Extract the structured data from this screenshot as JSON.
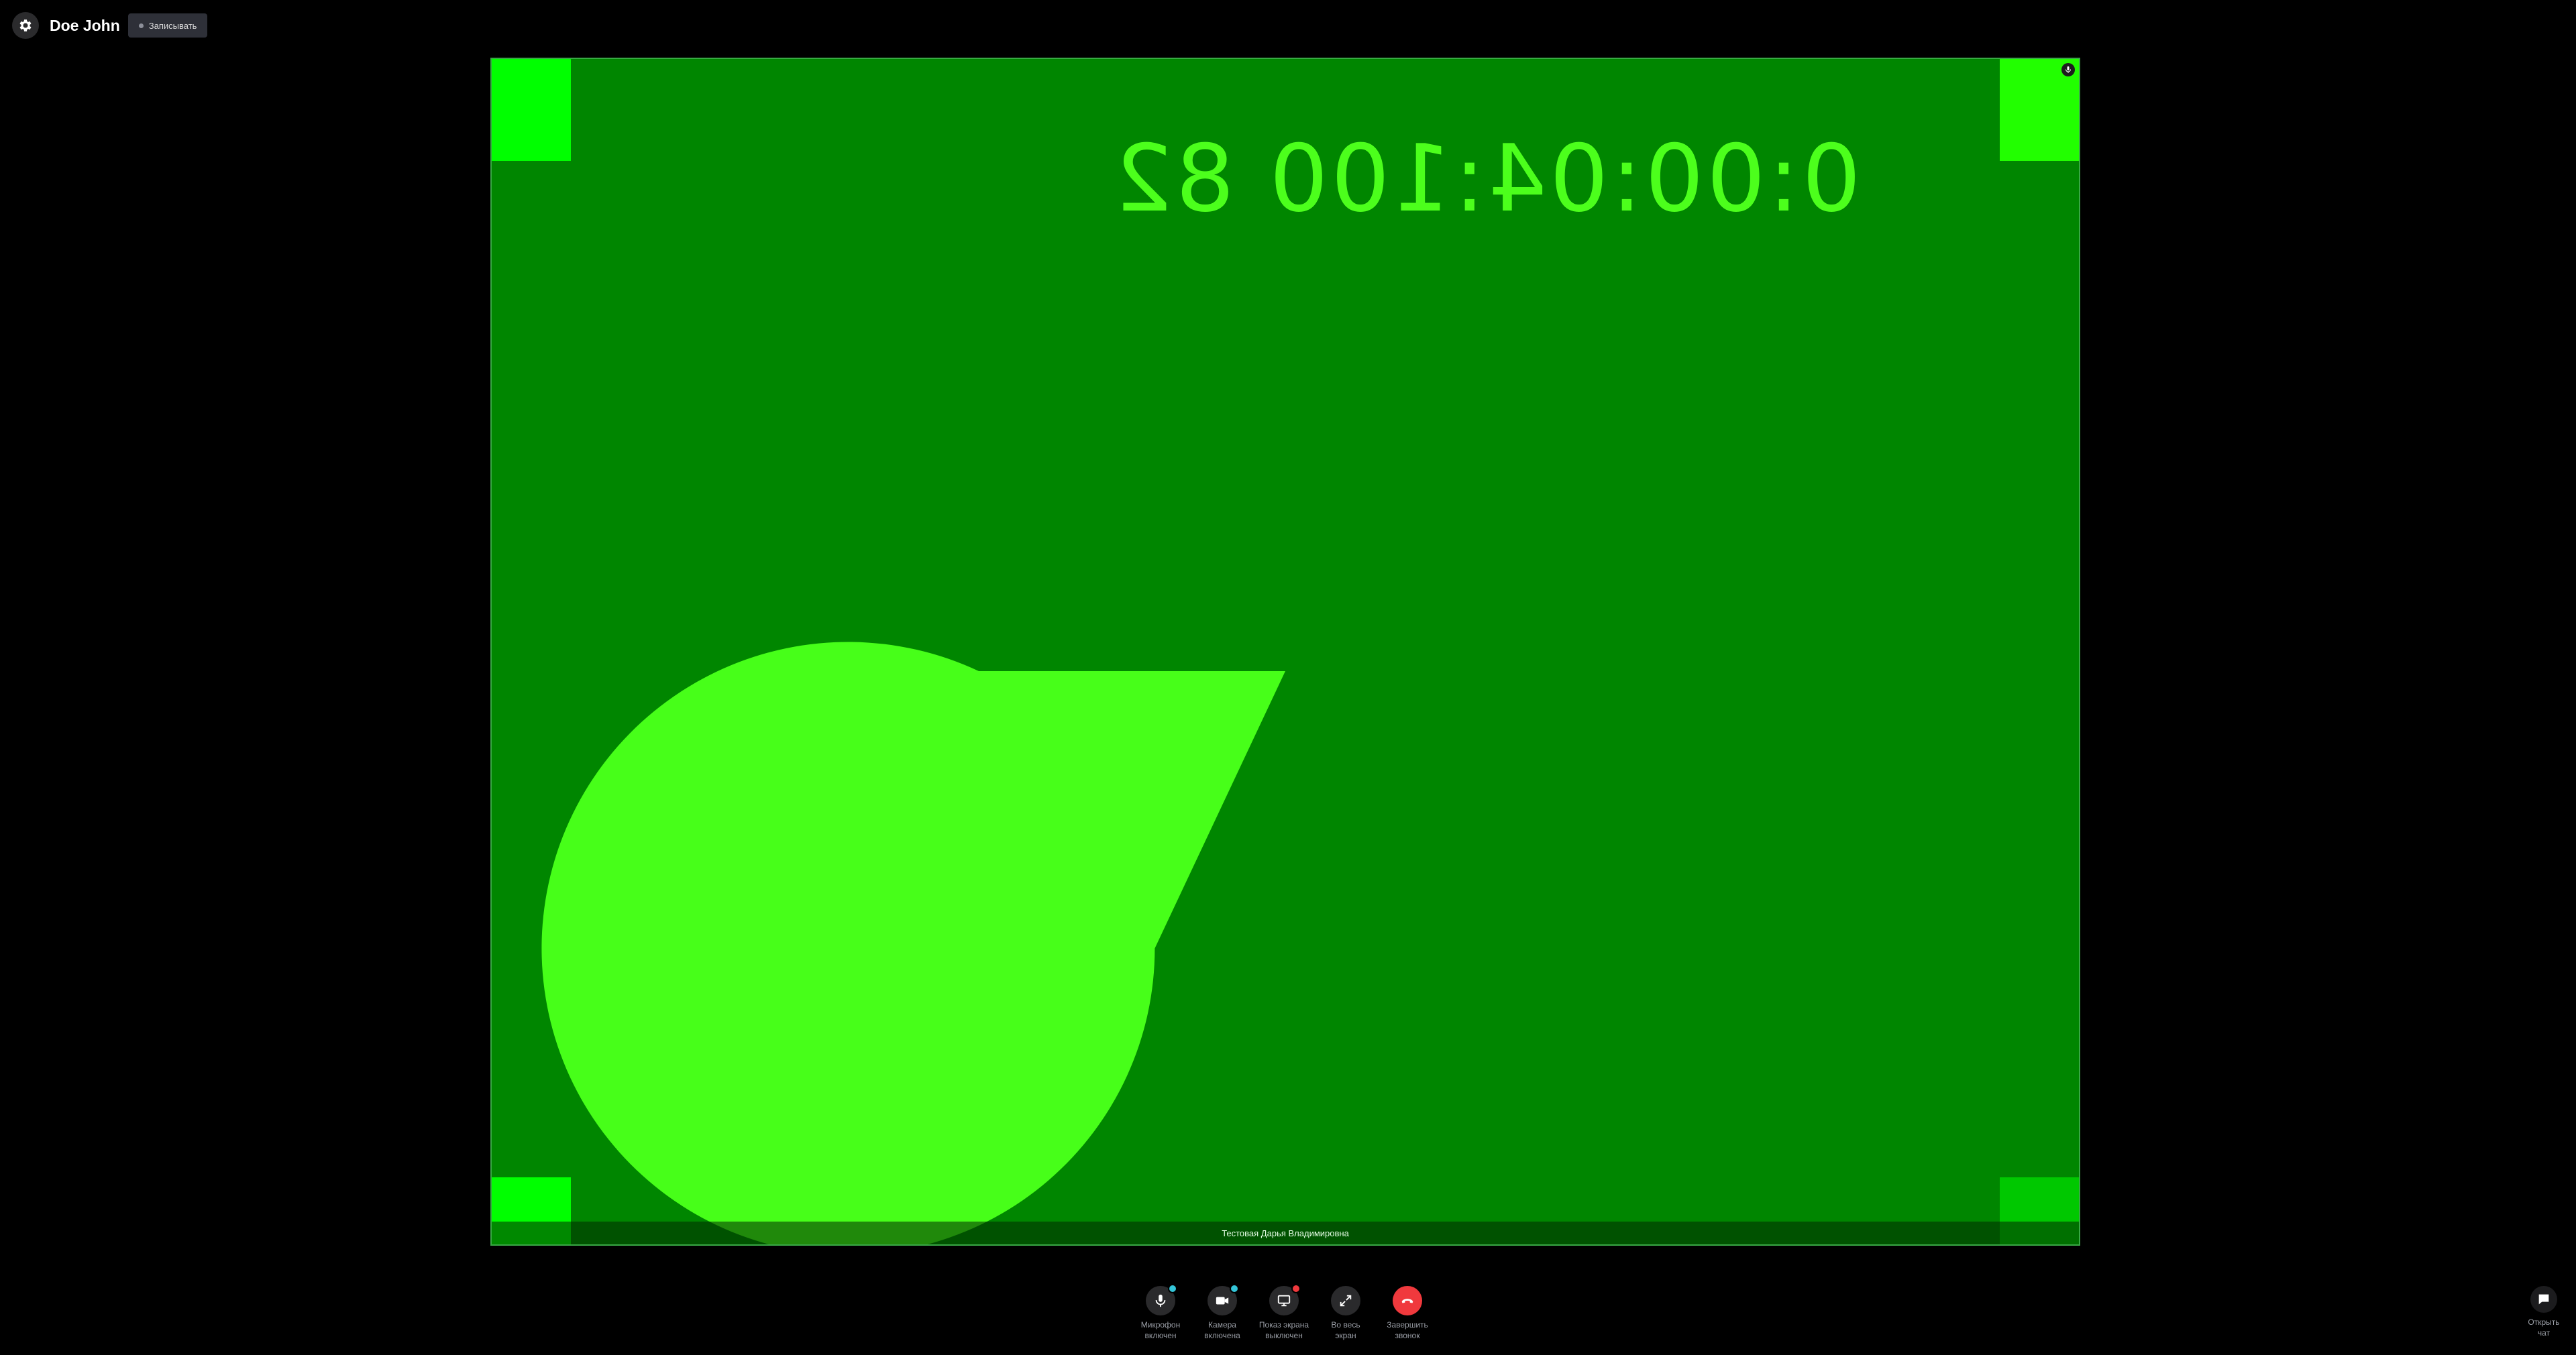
{
  "header": {
    "user_name": "Doe John",
    "record_label": "Записывать",
    "settings_icon": "gear-icon"
  },
  "video": {
    "participant_name": "Тестовая Дарья Владимировна",
    "overlay_timecode": "0:00:04:100 82",
    "mic_indicator_icon": "microphone-icon",
    "pie_fraction": 0.82,
    "colors": {
      "background": "#008600",
      "pie": "#47ff19",
      "corner": "#00ff00",
      "border": "#39a845"
    }
  },
  "controls": [
    {
      "id": "mic",
      "label_line1": "Микрофон",
      "label_line2": "включен",
      "icon": "microphone-icon",
      "badge_color": "#34c5d8"
    },
    {
      "id": "camera",
      "label_line1": "Камера",
      "label_line2": "включена",
      "icon": "camera-icon",
      "badge_color": "#34c5d8"
    },
    {
      "id": "screen",
      "label_line1": "Показ экрана",
      "label_line2": "выключен",
      "icon": "screen-share-icon",
      "badge_color": "#f0393d"
    },
    {
      "id": "fullscreen",
      "label_line1": "Во весь",
      "label_line2": "экран",
      "icon": "expand-icon"
    },
    {
      "id": "hangup",
      "label_line1": "Завершить",
      "label_line2": "звонок",
      "icon": "hang-up-icon",
      "accent": "#f0393d"
    }
  ],
  "chat": {
    "label_line1": "Открыть",
    "label_line2": "чат",
    "icon": "chat-icon"
  }
}
